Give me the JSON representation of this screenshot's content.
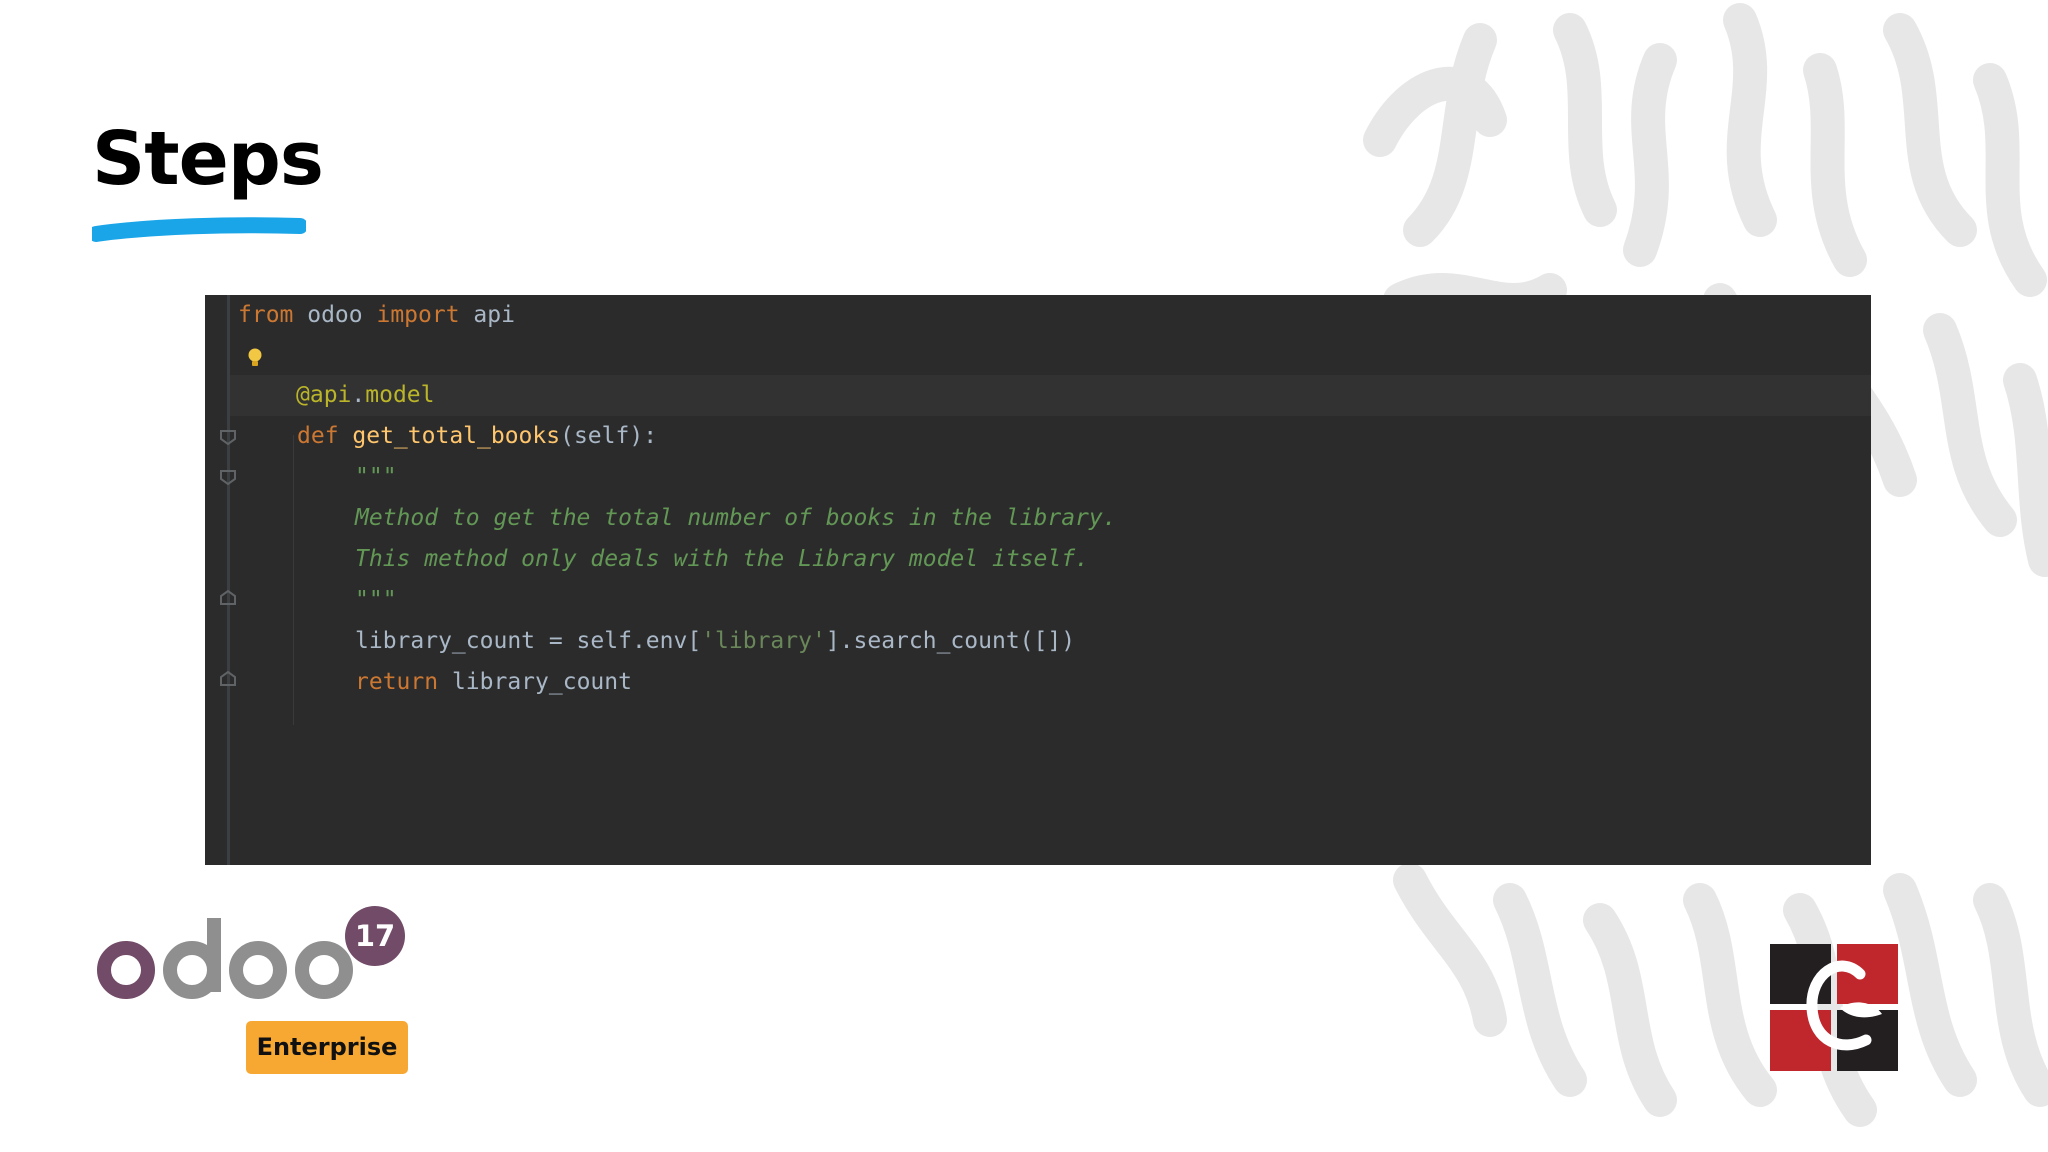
{
  "slide": {
    "title": "Steps"
  },
  "code": {
    "line1": {
      "t1": "from",
      "t2": " odoo ",
      "t3": "import",
      "t4": " api"
    },
    "line3": {
      "t1": "@api",
      "t2": ".",
      "t3": "model"
    },
    "line4": {
      "t1": "def ",
      "t2": "get_total_books",
      "t3": "(self):"
    },
    "line5": {
      "t1": "\"\"\""
    },
    "line6": {
      "t1": "Method to get the total number of books in the library."
    },
    "line7": {
      "t1": "This method only deals with the Library model itself."
    },
    "line8": {
      "t1": "\"\"\""
    },
    "line9": {
      "t1": "library_count = self.env[",
      "t2": "'library'",
      "t3": "].search_count([])"
    },
    "line10": {
      "t1": "return",
      "t2": " library_count"
    }
  },
  "branding": {
    "odoo_logo_text": "odoo",
    "version_badge": "17",
    "edition_label": "Enterprise",
    "company_logo_letters": "CE"
  },
  "icons": {
    "code_hint": "lightbulb-icon",
    "fold": "fold-marker-icon",
    "decoration": "squiggle-pattern"
  },
  "colors": {
    "code_background": "#2b2b2b",
    "keyword": "#cc7832",
    "function": "#ffc66d",
    "docstring": "#629755",
    "string": "#6a8759",
    "decorator": "#bbb529",
    "underline": "#1aa5e8",
    "odoo_purple": "#714b67",
    "odoo_gray": "#8f8f8f",
    "badge_orange": "#f7a832",
    "logo_red": "#c0272d",
    "logo_dark": "#231f20"
  }
}
